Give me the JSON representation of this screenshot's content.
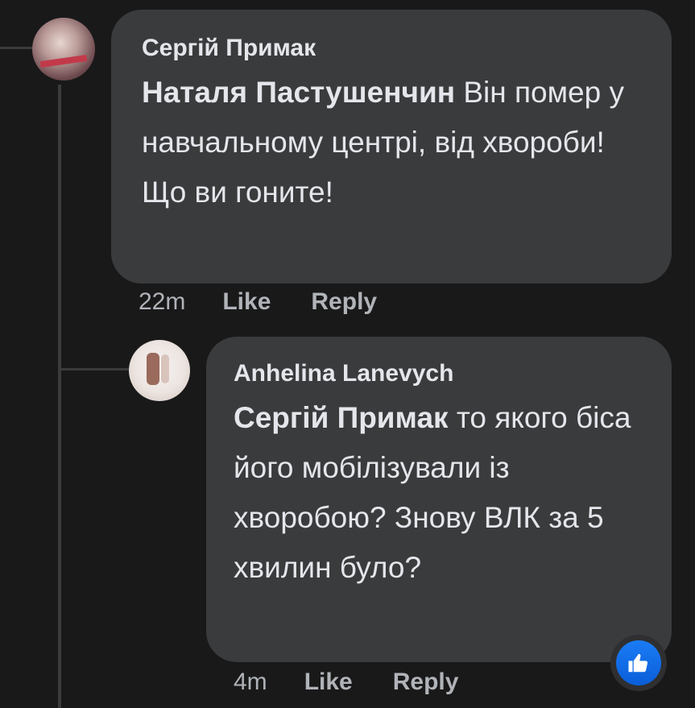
{
  "comments": [
    {
      "author": "Сергій Примак",
      "mention": "Наталя Пастушенчин",
      "text": " Він помер у навчальному центрі, від хвороби! Що ви гоните!",
      "time": "22m",
      "like_label": "Like",
      "reply_label": "Reply",
      "avatar_icon": "user-avatar"
    },
    {
      "author": "Anhelina Lanevych",
      "mention": "Сергій Примак",
      "text": " то якого біса його мобілізували із хворобою? Знову ВЛК за 5 хвилин було?",
      "time": "4m",
      "like_label": "Like",
      "reply_label": "Reply",
      "avatar_icon": "user-avatar",
      "reaction_icon": "thumbs-up-icon"
    }
  ],
  "colors": {
    "background": "#19191a",
    "bubble": "#3a3b3c",
    "text": "#e4e6eb",
    "secondary_text": "#b0b3b8",
    "like_blue": "#1a7cf5"
  }
}
